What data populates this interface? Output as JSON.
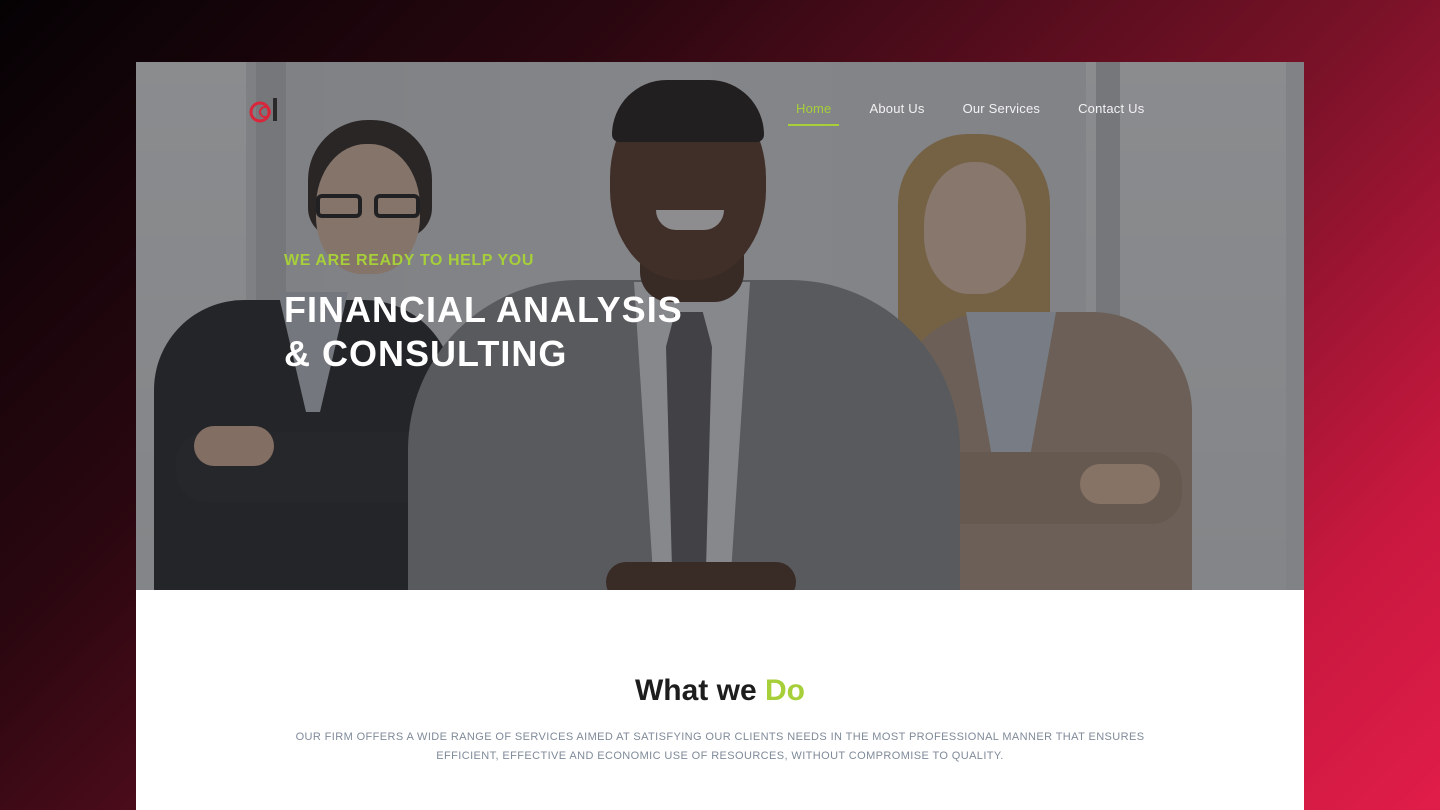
{
  "nav": {
    "items": [
      {
        "label": "Home",
        "active": true
      },
      {
        "label": "About Us",
        "active": false
      },
      {
        "label": "Our Services",
        "active": false
      },
      {
        "label": "Contact Us",
        "active": false
      }
    ]
  },
  "logo": {
    "icon": "company-logo"
  },
  "hero": {
    "kicker": "WE ARE READY TO HELP YOU",
    "headline_line1": "FINANCIAL ANALYSIS",
    "headline_line2": "& CONSULTING"
  },
  "section": {
    "title_main": "What we ",
    "title_accent": "Do",
    "body": "OUR FIRM OFFERS A WIDE RANGE OF SERVICES AIMED AT SATISFYING OUR CLIENTS NEEDS IN THE MOST PROFESSIONAL MANNER THAT ENSURES EFFICIENT, EFFECTIVE AND ECONOMIC USE OF RESOURCES, WITHOUT COMPROMISE TO QUALITY."
  },
  "colors": {
    "accent": "#a6cf3a",
    "logo_red": "#d8263b",
    "background_gradient_end": "#e01d48"
  }
}
